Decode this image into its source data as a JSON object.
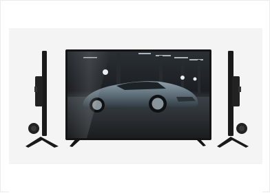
{
  "product": {
    "subject": "tv-product-photo",
    "colors": {
      "background": "#f4f4f5",
      "bezel": "#141414",
      "screen_dark": "#1c2024",
      "car_body": "#5d6d78"
    }
  }
}
